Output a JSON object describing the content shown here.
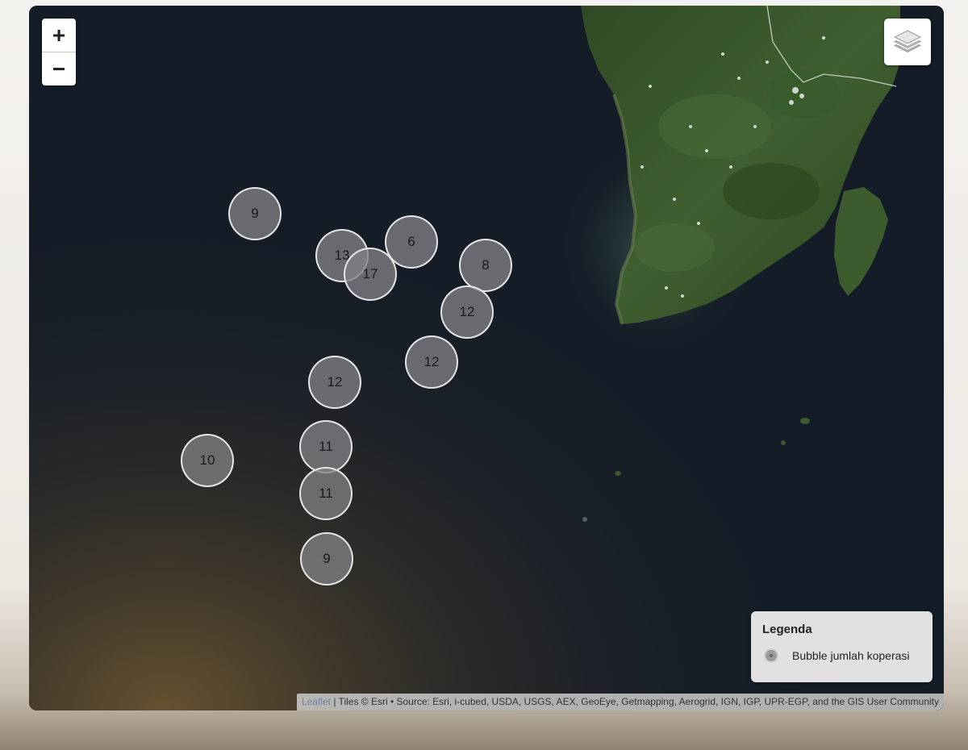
{
  "map": {
    "zoom_in_label": "+",
    "zoom_out_label": "−",
    "layers_icon": "layers-icon",
    "bubble_color": "#808084",
    "bubble_border_color": "#ececec",
    "ocean_color": "#141c27",
    "land_color": "#3c5a2e"
  },
  "bubbles": [
    {
      "label": "9"
    },
    {
      "label": "13"
    },
    {
      "label": "17"
    },
    {
      "label": "6"
    },
    {
      "label": "8"
    },
    {
      "label": "12"
    },
    {
      "label": "12"
    },
    {
      "label": "12"
    },
    {
      "label": "10"
    },
    {
      "label": "11"
    },
    {
      "label": "11"
    },
    {
      "label": "9"
    }
  ],
  "legend": {
    "title": "Legenda",
    "item_label": "Bubble jumlah koperasi"
  },
  "attribution": {
    "leaflet": "Leaflet",
    "text": " | Tiles © Esri • Source: Esri, i-cubed, USDA, USGS, AEX, GeoEye, Getmapping, Aerogrid, IGN, IGP, UPR-EGP, and the GIS User Community"
  }
}
